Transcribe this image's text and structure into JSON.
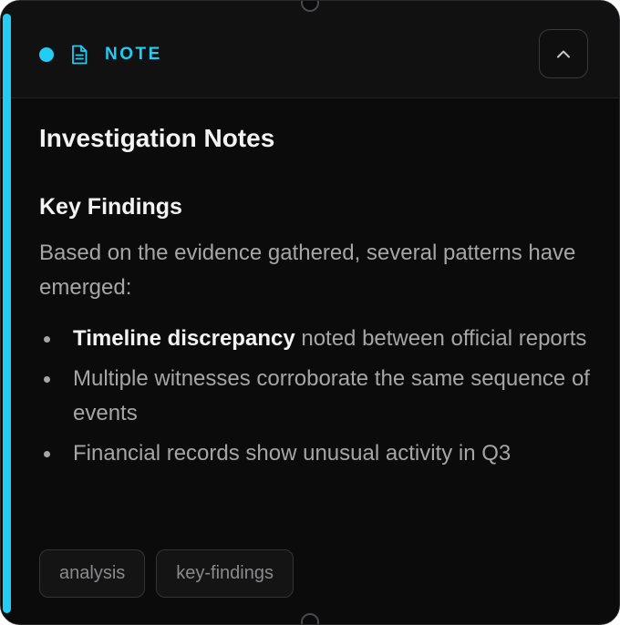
{
  "note": {
    "type_label": "NOTE",
    "accent_color": "#22ccf2",
    "header_icon": "document-icon",
    "collapse_icon": "chevron-up-icon",
    "title": "Investigation Notes",
    "section_heading": "Key Findings",
    "intro": "Based on the evidence gathered, several patterns have emerged:",
    "findings": [
      {
        "bold": "Timeline discrepancy",
        "text": " noted between official reports"
      },
      {
        "bold": "",
        "text": "Multiple witnesses corroborate the same sequence of events"
      },
      {
        "bold": "",
        "text": "Financial records show unusual activity in Q3"
      }
    ],
    "tags": [
      "analysis",
      "key-findings"
    ]
  }
}
